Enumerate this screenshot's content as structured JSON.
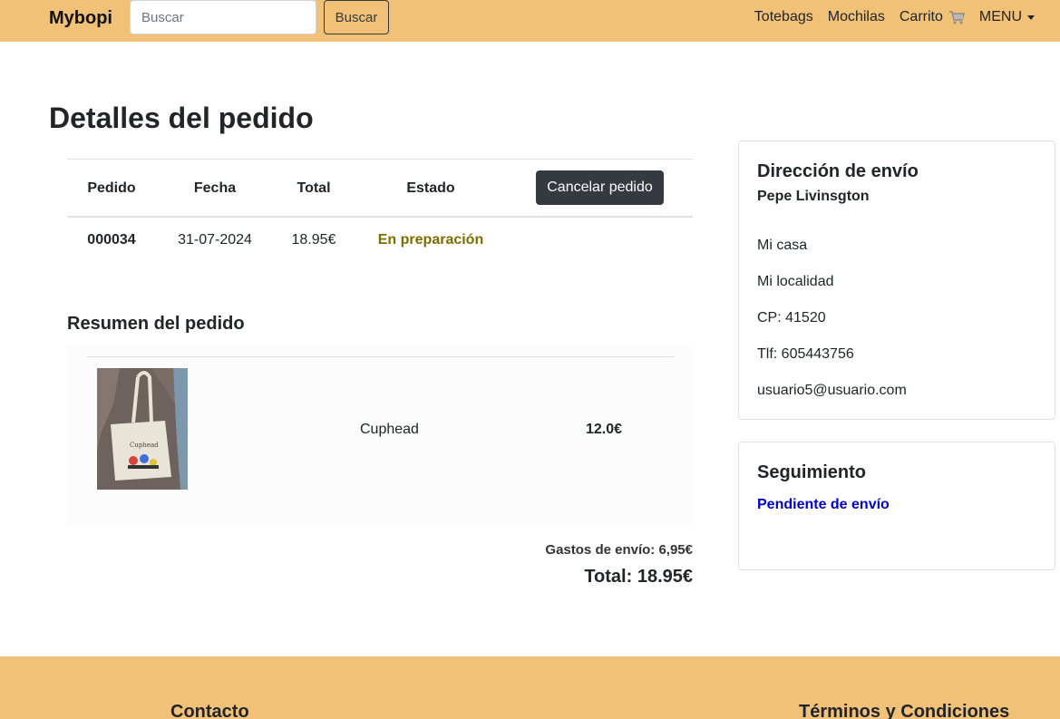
{
  "navbar": {
    "brand": "Mybopi",
    "search_placeholder": "Buscar",
    "search_button": "Buscar",
    "links": [
      "Totebags",
      "Mochilas",
      "Carrito",
      "MENU"
    ],
    "cart_icon": "cart-icon",
    "menu_icon": "caret-down-icon",
    "bg_color": "#f1c177"
  },
  "page": {
    "title": "Detalles del pedido"
  },
  "order": {
    "headers": [
      "Pedido",
      "Fecha",
      "Total",
      "Estado"
    ],
    "cancel_button": "Cancelar pedido",
    "row": {
      "id": "000034",
      "date": "31-07-2024",
      "total": "18.95€",
      "status": "En preparación"
    },
    "status_color": "#7b6d00"
  },
  "summary": {
    "title": "Resumen del pedido",
    "items": [
      {
        "name": "Cuphead",
        "price": "12.0€",
        "image": "cuphead-totebag-image"
      }
    ],
    "shipping": "Gastos de envío: 6,95€",
    "total": "Total: 18.95€"
  },
  "address": {
    "title": "Dirección de envío",
    "name": "Pepe Livinsgton",
    "lines": [
      "Mi casa",
      "Mi localidad",
      "CP: 41520",
      "Tlf: 605443756",
      "usuario5@usuario.com"
    ]
  },
  "tracking": {
    "title": "Seguimiento",
    "status": "Pendiente de envío",
    "status_color": "#0000cc"
  },
  "footer": {
    "headings": [
      "Contacto",
      "Términos y Condiciones"
    ]
  }
}
